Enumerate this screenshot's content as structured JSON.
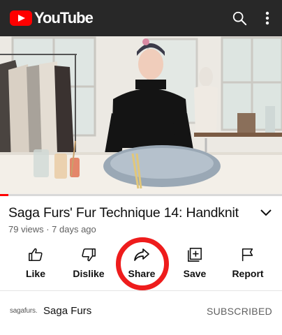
{
  "header": {
    "brand": "YouTube",
    "search_icon": "search-icon",
    "menu_icon": "more-vert-icon"
  },
  "video": {
    "title": "Saga Furs' Fur Technique 14: Handknit",
    "views": "79 views",
    "age": "7 days ago",
    "progress_fraction": 0.03
  },
  "actions": [
    {
      "label": "Like",
      "icon": "thumb-up-icon"
    },
    {
      "label": "Dislike",
      "icon": "thumb-down-icon"
    },
    {
      "label": "Share",
      "icon": "share-icon"
    },
    {
      "label": "Save",
      "icon": "playlist-add-icon"
    },
    {
      "label": "Report",
      "icon": "flag-icon"
    }
  ],
  "channel": {
    "logo_text": "sagafurs.",
    "name": "Saga Furs",
    "subscribe_label": "SUBSCRIBED"
  },
  "colors": {
    "brand_red": "#ff0000",
    "highlight_circle": "#ee1c1c",
    "topbar": "#282828"
  }
}
